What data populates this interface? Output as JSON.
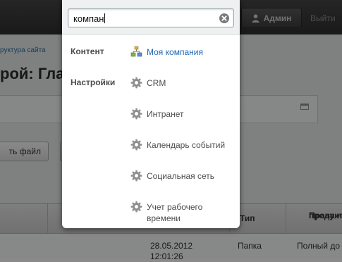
{
  "topbar": {
    "admin_label": "Админ",
    "logout_label": "Выйти"
  },
  "page": {
    "breadcrumb": "руктура сайта",
    "title": "рой: Гла",
    "upload_button": "ть файл",
    "table": {
      "headers": {
        "type": "Тип",
        "rights_line1": "Права на",
        "rights_line2": "продукта"
      },
      "row": {
        "date": "28.05.2012",
        "time": "12:01:26",
        "type": "Папка",
        "rights": "Полный до"
      }
    }
  },
  "search": {
    "query": "компан",
    "categories": [
      {
        "label": "Контент",
        "items": [
          {
            "before": "Моя ",
            "match": "компан",
            "after": "ия",
            "icon": "structure-icon"
          }
        ]
      },
      {
        "label": "Настройки",
        "items": [
          {
            "text": "CRM",
            "icon": "gear-icon"
          },
          {
            "text": "Интранет",
            "icon": "gear-icon"
          },
          {
            "text": "Календарь событий",
            "icon": "gear-icon"
          },
          {
            "text": "Социальная сеть",
            "icon": "gear-icon"
          },
          {
            "text": "Учет рабочего времени",
            "icon": "gear-icon"
          }
        ]
      }
    ]
  }
}
